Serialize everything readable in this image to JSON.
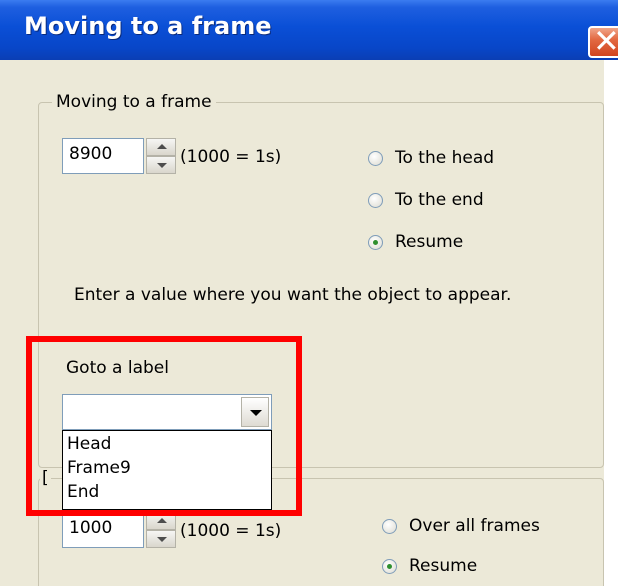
{
  "window": {
    "title": "Moving to a frame",
    "close_glyph": "✕"
  },
  "group1": {
    "legend": "Moving to a frame",
    "frame_value": "8900",
    "unit_hint": "(1000 = 1s)",
    "radios": [
      {
        "label": "To the head",
        "checked": false
      },
      {
        "label": "To the end",
        "checked": false
      },
      {
        "label": "Resume",
        "checked": true
      }
    ],
    "help_text": "Enter a value where you want the object to appear."
  },
  "goto_label": {
    "label": "Goto a label",
    "selected_value": "",
    "options": [
      "Head",
      "Frame9",
      "End"
    ]
  },
  "group2": {
    "legend_partial": "[",
    "duration_value": "1000",
    "unit_hint": "(1000 = 1s)",
    "radios": [
      {
        "label": "Over all frames",
        "checked": false
      },
      {
        "label": "Resume",
        "checked": true
      }
    ]
  },
  "colors": {
    "titlebar": "#0a4fd6",
    "close_button": "#d1451f",
    "dialog_background": "#ece9d8",
    "annotation_highlight": "#ff0000"
  }
}
